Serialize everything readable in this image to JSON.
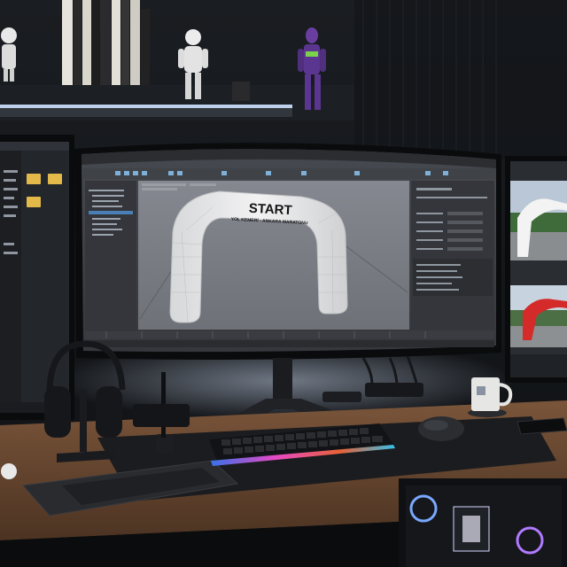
{
  "scene": {
    "arch_title": "START",
    "arch_subtitle": "YOL KEMERİ - ANKARA MARATONU"
  },
  "colors": {
    "wall": "#15181c",
    "desk_wood": "#6a4a32",
    "desk_mat": "#1b1c1f",
    "screen_ui": "#3b3d42",
    "viewport": "#7a7d82",
    "arch": "#e9e9ea",
    "shelf_led": "#cfe3ff",
    "keyboard_rgb": "#ff4d6d",
    "finish_arch_red": "#d42a2a"
  },
  "icons": {
    "folders": "folder-icon",
    "headphones": "headphones-icon",
    "mug": "mug-icon",
    "mouse": "mouse-icon"
  }
}
